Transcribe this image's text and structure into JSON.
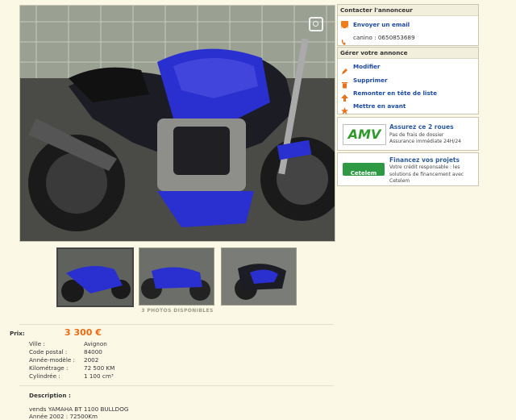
{
  "contact": {
    "title": "Contacter l'annonceur",
    "email_link": "Envoyer un email",
    "phone_label": "canino : 0650853689"
  },
  "manage": {
    "title": "Gérer votre annonce",
    "items": [
      {
        "label": "Modifier",
        "icon": "pencil-icon"
      },
      {
        "label": "Supprimer",
        "icon": "trash-icon"
      },
      {
        "label": "Remonter en tête de liste",
        "icon": "arrow-up-icon"
      },
      {
        "label": "Mettre en avant",
        "icon": "star-icon"
      }
    ]
  },
  "amv": {
    "logo": "AMV",
    "title": "Assurez ce 2 roues",
    "line1": "Pas de frais de dossier",
    "line2": "Assurance immédiate 24H/24"
  },
  "cetelem": {
    "logo": "Cetelem",
    "title": "Financez vos projets",
    "text": "Votre crédit responsable : les solutions de financement avec Cetelem"
  },
  "photos": {
    "count_label": "3 PHOTOS DISPONIBLES",
    "thumb_count": 3
  },
  "details": {
    "price_label": "Prix:",
    "price_value": "3 300 €",
    "rows": [
      {
        "label": "Ville :",
        "value": "Avignon"
      },
      {
        "label": "Code postal :",
        "value": "84000"
      },
      {
        "label": "Année-modèle :",
        "value": "2002"
      },
      {
        "label": "Kilométrage :",
        "value": "72 500 KM"
      },
      {
        "label": "Cylindrée :",
        "value": "1 100 cm³"
      }
    ]
  },
  "description": {
    "title": "Description :",
    "lines": [
      "vends YAMAHA BT 1100 BULLDOG",
      "Année 2002 : 72500Km"
    ]
  },
  "colors": {
    "price": "#ee6a13",
    "link": "#1a48a8",
    "background": "#fbf9e6",
    "bike_blue": "#2a2fd0"
  }
}
